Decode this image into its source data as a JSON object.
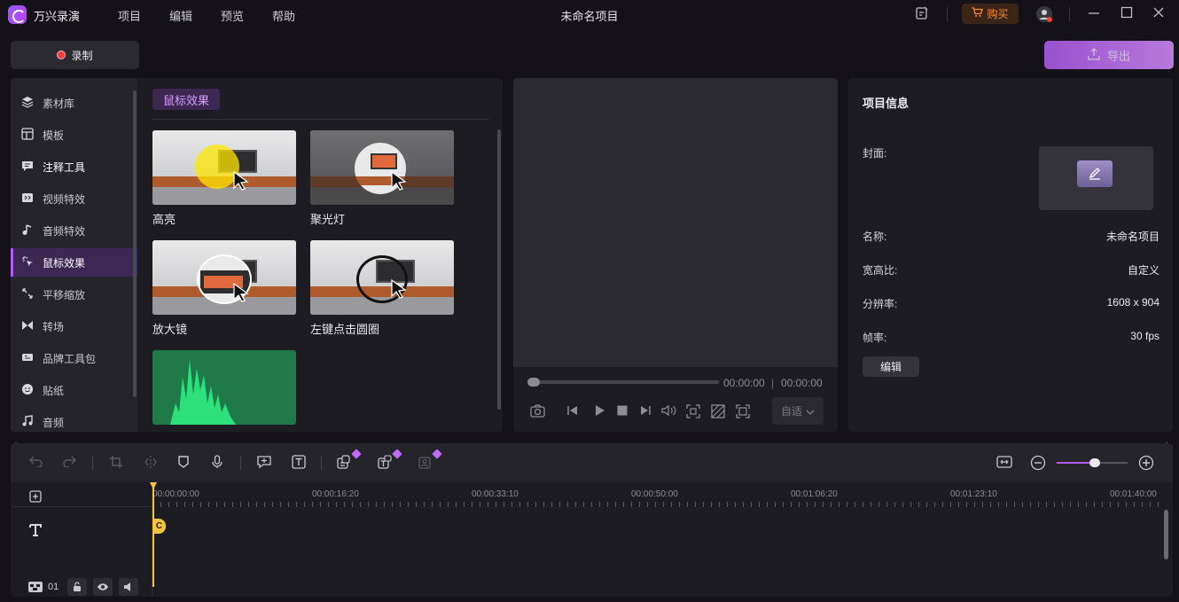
{
  "app": {
    "name": "万兴录演",
    "project_title": "未命名项目"
  },
  "menu": [
    "项目",
    "编辑",
    "预览",
    "帮助"
  ],
  "titlebar": {
    "buy_label": "购买"
  },
  "actions": {
    "record_label": "录制",
    "export_label": "导出"
  },
  "sidebar": {
    "items": [
      {
        "label": "素材库",
        "icon": "layers-icon"
      },
      {
        "label": "模板",
        "icon": "template-icon"
      },
      {
        "label": "注释工具",
        "icon": "annotation-icon"
      },
      {
        "label": "视频特效",
        "icon": "video-effects-icon"
      },
      {
        "label": "音频特效",
        "icon": "audio-effects-icon"
      },
      {
        "label": "鼠标效果",
        "icon": "cursor-effects-icon",
        "active": true
      },
      {
        "label": "平移缩放",
        "icon": "pan-zoom-icon"
      },
      {
        "label": "转场",
        "icon": "transition-icon"
      },
      {
        "label": "品牌工具包",
        "icon": "brand-kit-icon"
      },
      {
        "label": "贴纸",
        "icon": "sticker-icon"
      },
      {
        "label": "音频",
        "icon": "music-icon"
      }
    ]
  },
  "effects": {
    "section_title": "鼠标效果",
    "cards": [
      {
        "label": "高亮"
      },
      {
        "label": "聚光灯"
      },
      {
        "label": "放大镜"
      },
      {
        "label": "左键点击圆圈"
      }
    ]
  },
  "preview": {
    "current_time": "00:00:00",
    "total_time": "00:00:00",
    "ratio_select": "自适"
  },
  "project_info": {
    "title": "项目信息",
    "cover_label": "封面:",
    "name_label": "名称:",
    "name_value": "未命名项目",
    "aspect_label": "宽高比:",
    "aspect_value": "自定义",
    "resolution_label": "分辨率:",
    "resolution_value": "1608 x 904",
    "fps_label": "帧率:",
    "fps_value": "30 fps",
    "edit_label": "编辑"
  },
  "timeline": {
    "ruler": [
      "00:00:00:00",
      "00:00:16:20",
      "00:00:33:10",
      "00:00:50:00",
      "00:01:06:20",
      "00:01:23:10",
      "00:01:40:00"
    ],
    "track_number": "01",
    "clip_marker": "C"
  },
  "colors": {
    "accent": "#b45cf0",
    "playhead": "#f5c242",
    "record": "#ff3b3b",
    "buy": "#ff8a3d"
  }
}
